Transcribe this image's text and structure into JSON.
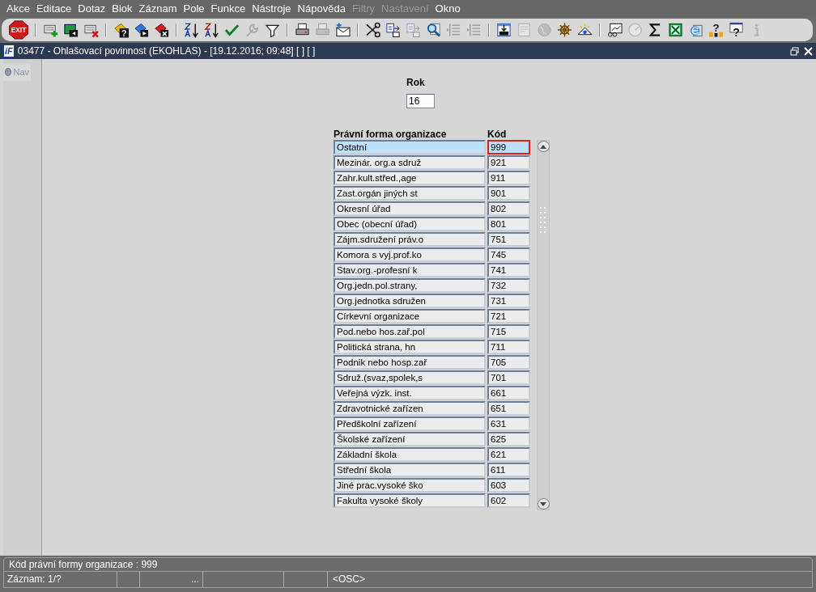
{
  "menu": [
    {
      "label": "Akce",
      "disabled": false
    },
    {
      "label": "Editace",
      "disabled": false
    },
    {
      "label": "Dotaz",
      "disabled": false
    },
    {
      "label": "Blok",
      "disabled": false
    },
    {
      "label": "Záznam",
      "disabled": false
    },
    {
      "label": "Pole",
      "disabled": false
    },
    {
      "label": "Funkce",
      "disabled": false
    },
    {
      "label": "Nástroje",
      "disabled": false
    },
    {
      "label": "Nápověda",
      "disabled": false
    },
    {
      "label": "Filtry",
      "disabled": true
    },
    {
      "label": "Nastavení",
      "disabled": true
    },
    {
      "label": "Okno",
      "disabled": false
    }
  ],
  "toolbar": [
    [
      {
        "label": "EXIT",
        "disabled": false
      }
    ],
    [
      {
        "disabled": false
      },
      {
        "disabled": false
      },
      {
        "disabled": false
      }
    ],
    [
      {
        "label": "?",
        "disabled": false
      },
      {
        "disabled": false
      },
      {
        "disabled": false
      }
    ],
    [
      {
        "disabled": false
      },
      {
        "disabled": false
      },
      {
        "disabled": false
      },
      {
        "disabled": true
      },
      {
        "disabled": false
      }
    ],
    [
      {
        "disabled": false
      },
      {
        "disabled": true
      },
      {
        "disabled": false
      }
    ],
    [
      {
        "disabled": false
      },
      {
        "disabled": false
      },
      {
        "disabled": true
      },
      {
        "disabled": false
      },
      {
        "disabled": true
      },
      {
        "disabled": true
      }
    ],
    [
      {
        "disabled": false
      },
      {
        "disabled": true
      },
      {
        "disabled": true
      },
      {
        "disabled": false
      },
      {
        "disabled": false
      }
    ],
    [
      {
        "disabled": false
      },
      {
        "disabled": true
      },
      {
        "disabled": false
      },
      {
        "disabled": false
      },
      {
        "disabled": false
      },
      {
        "label": "?",
        "disabled": false
      },
      {
        "label": "?",
        "disabled": false
      },
      {
        "disabled": true
      }
    ]
  ],
  "window": {
    "logo": "iF",
    "title": "03477 - Ohlašovací povinnost (EKOHLAS) - [19.12.2016; 09:48]  [ ]  [ ]"
  },
  "nav": {
    "label": "Nav",
    "selected": false
  },
  "rok": {
    "label": "Rok",
    "value": "16"
  },
  "table": {
    "columns": [
      "Právní forma organizace",
      "Kód"
    ],
    "rows": [
      {
        "name": "Ostatní",
        "code": "999",
        "selected": true
      },
      {
        "name": "Mezinár. org.a sdruž",
        "code": "921",
        "selected": false
      },
      {
        "name": "Zahr.kult.střed.,age",
        "code": "911",
        "selected": false
      },
      {
        "name": "Zast.orgán jiných st",
        "code": "901",
        "selected": false
      },
      {
        "name": "Okresní úřad",
        "code": "802",
        "selected": false
      },
      {
        "name": "Obec (obecní úřad)",
        "code": "801",
        "selected": false
      },
      {
        "name": "Zájm.sdružení práv.o",
        "code": "751",
        "selected": false
      },
      {
        "name": "Komora s vyj.prof.ko",
        "code": "745",
        "selected": false
      },
      {
        "name": "Stav.org.-profesní k",
        "code": "741",
        "selected": false
      },
      {
        "name": "Org.jedn.pol.strany,",
        "code": "732",
        "selected": false
      },
      {
        "name": "Org.jednotka sdružen",
        "code": "731",
        "selected": false
      },
      {
        "name": "Církevní organizace",
        "code": "721",
        "selected": false
      },
      {
        "name": "Pod.nebo hos.zař.pol",
        "code": "715",
        "selected": false
      },
      {
        "name": "Politická strana, hn",
        "code": "711",
        "selected": false
      },
      {
        "name": "Podnik nebo hosp.zař",
        "code": "705",
        "selected": false
      },
      {
        "name": "Sdruž.(svaz,spolek,s",
        "code": "701",
        "selected": false
      },
      {
        "name": "Veřejná výzk. inst.",
        "code": "661",
        "selected": false
      },
      {
        "name": "Zdravotnické zařízen",
        "code": "651",
        "selected": false
      },
      {
        "name": "Předškolní zařízení",
        "code": "631",
        "selected": false
      },
      {
        "name": "Školské zařízení",
        "code": "625",
        "selected": false
      },
      {
        "name": "Základní škola",
        "code": "621",
        "selected": false
      },
      {
        "name": "Střední škola",
        "code": "611",
        "selected": false
      },
      {
        "name": "Jiné prac.vysoké ško",
        "code": "603",
        "selected": false
      },
      {
        "name": "Fakulta vysoké školy",
        "code": "602",
        "selected": false
      }
    ]
  },
  "status_bar": {
    "message": "Kód právní formy organizace : 999",
    "record": "Záznam: 1/?",
    "field_4": "...",
    "mode": "<OSC>"
  }
}
